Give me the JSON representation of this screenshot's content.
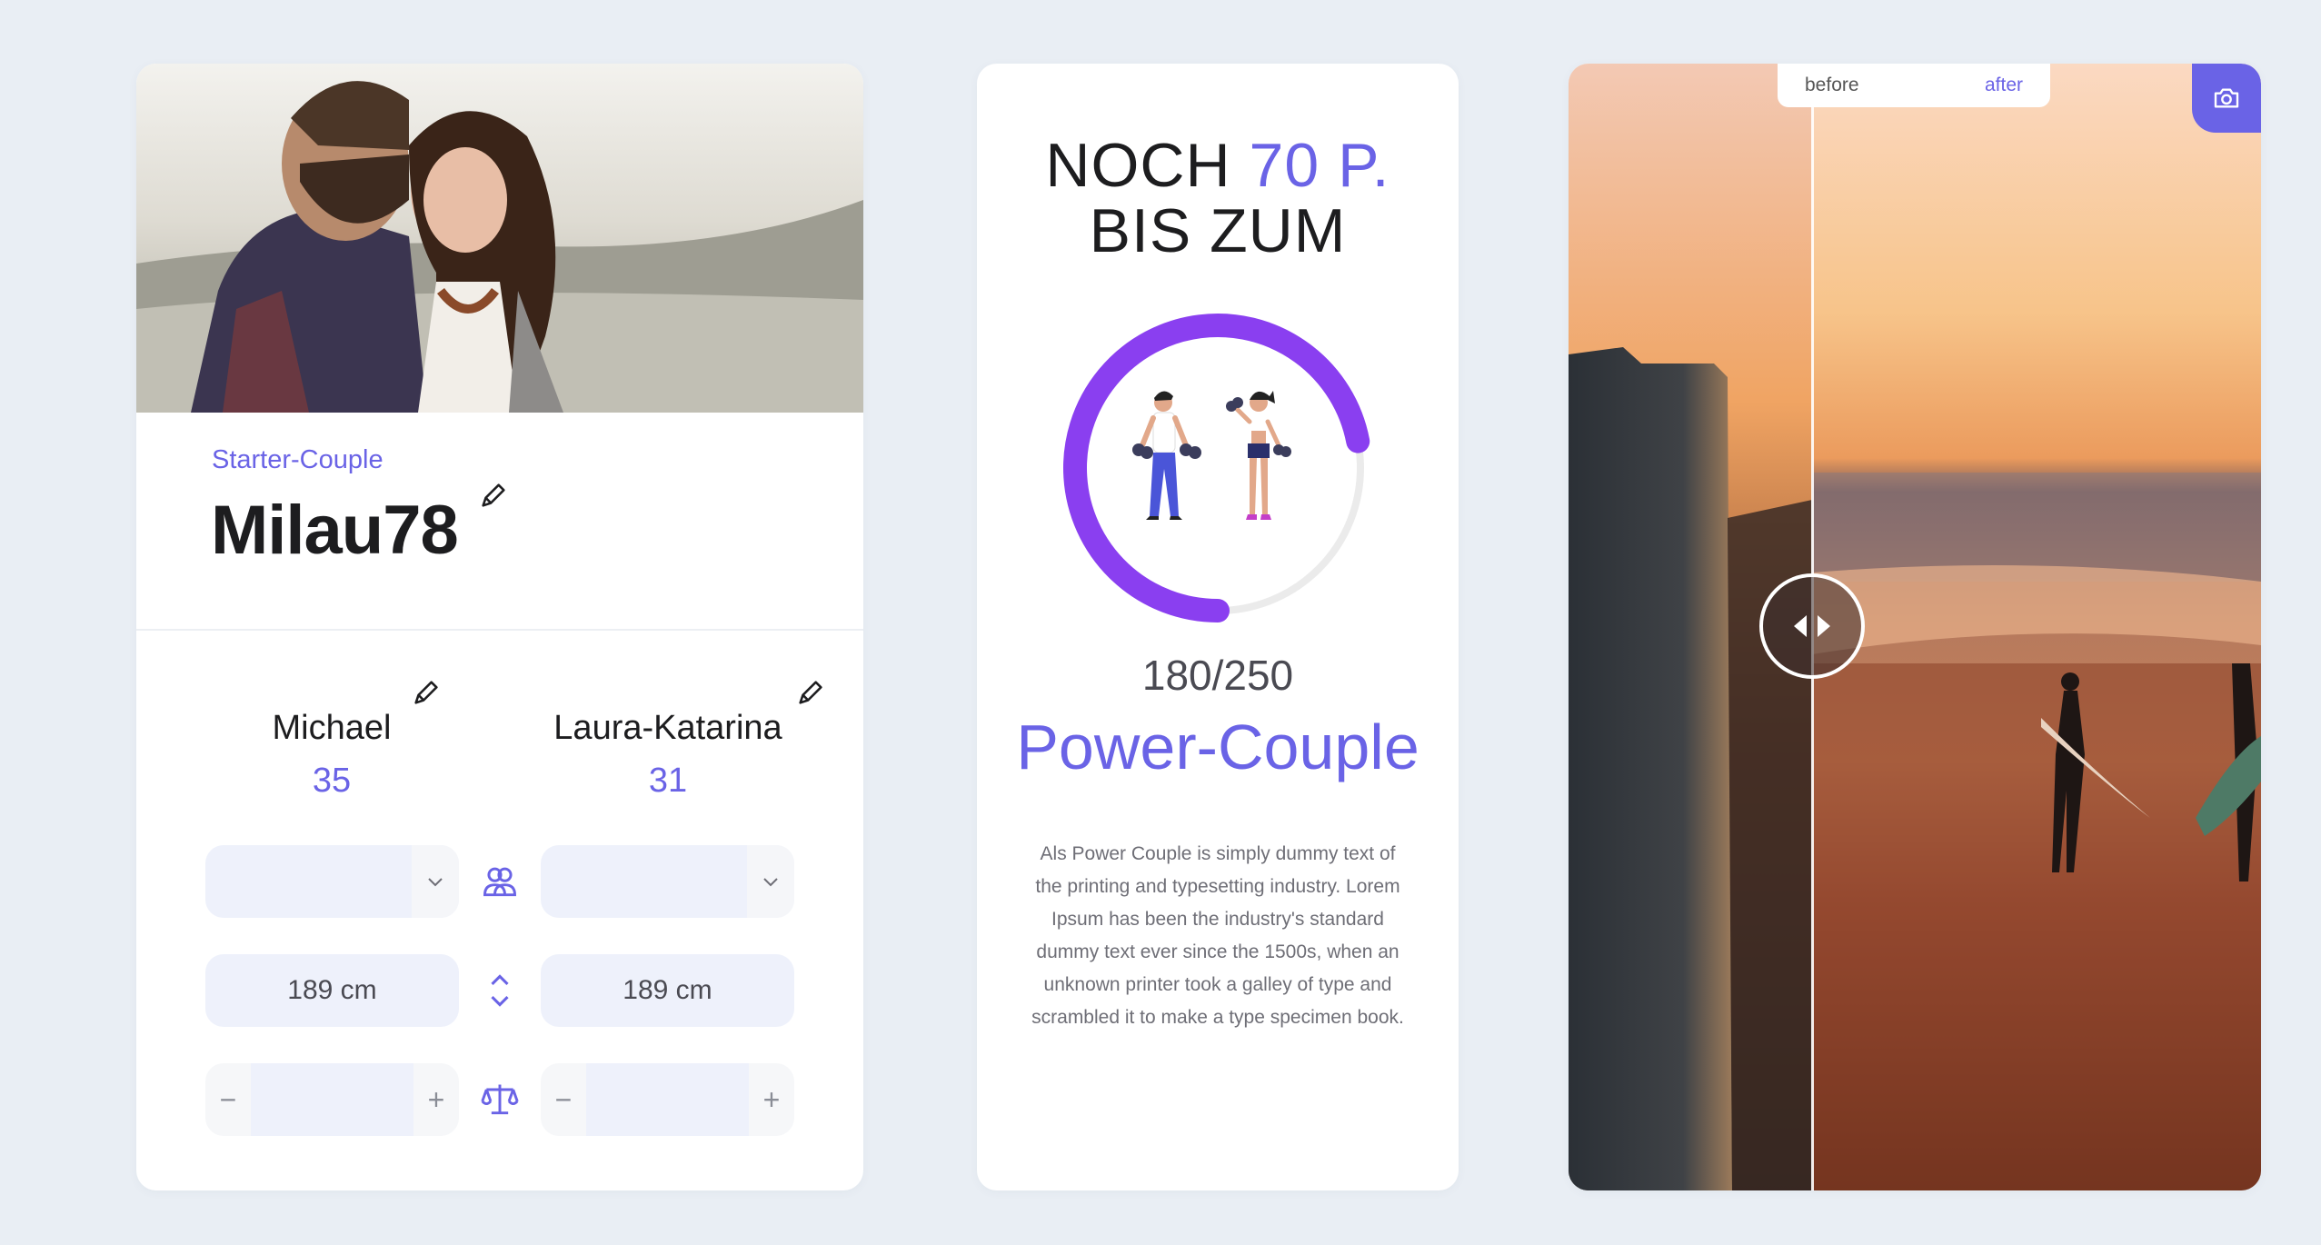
{
  "profile": {
    "tier": "Starter-Couple",
    "username": "Milau78",
    "partner1": {
      "name": "Michael",
      "age": "35",
      "height": "189 cm"
    },
    "partner2": {
      "name": "Laura-Katarina",
      "age": "31",
      "height": "189 cm"
    },
    "stepper": {
      "minus": "−",
      "plus": "+"
    }
  },
  "progress": {
    "headline_prefix": "NOCH",
    "headline_points": "70 P.",
    "headline_line2": "BIS ZUM",
    "score": "180/250",
    "score_value": 180,
    "score_max": 250,
    "level_name": "Power-Couple",
    "description": "Als Power Couple is simply dummy text of the printing and typesetting industry. Lorem Ipsum has been the industry's standard dummy text ever since the 1500s, when an unknown printer took a galley of type and scrambled it to make a type specimen book.",
    "ring_color": "#8a3ff0",
    "track_color": "#ebebeb"
  },
  "compare": {
    "before_label": "before",
    "after_label": "after",
    "camera_icon": "camera-icon"
  },
  "colors": {
    "accent": "#6a63e6",
    "background": "#e9eef4"
  }
}
